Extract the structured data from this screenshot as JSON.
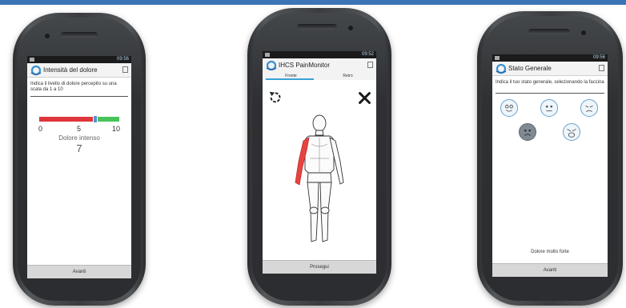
{
  "colors": {
    "accent": "#3d74b8",
    "pain_red": "#e0353b",
    "pain_green": "#47c35a",
    "tab_blue": "#3aa1d6"
  },
  "screen1": {
    "status_time": "09:56",
    "title": "Intensità del dolore",
    "description": "Indica il livello di dolore percepito su una scala da 1 a 10",
    "scale_min": "0",
    "scale_mid": "5",
    "scale_max": "10",
    "level_label": "Dolore intenso",
    "level_value": "7",
    "slider_fraction": 0.7,
    "button": "Avanti"
  },
  "screen2": {
    "status_time": "09:52",
    "title": "IHCS PainMonitor",
    "tabs": [
      "Fronte",
      "Retro"
    ],
    "button": "Prosegui"
  },
  "screen3": {
    "status_time": "09:56",
    "title": "Stato Generale",
    "description": "Indica il tuo stato generale, selezionando la faccina",
    "selected_label": "Dolore molto forte",
    "button": "Avanti"
  }
}
